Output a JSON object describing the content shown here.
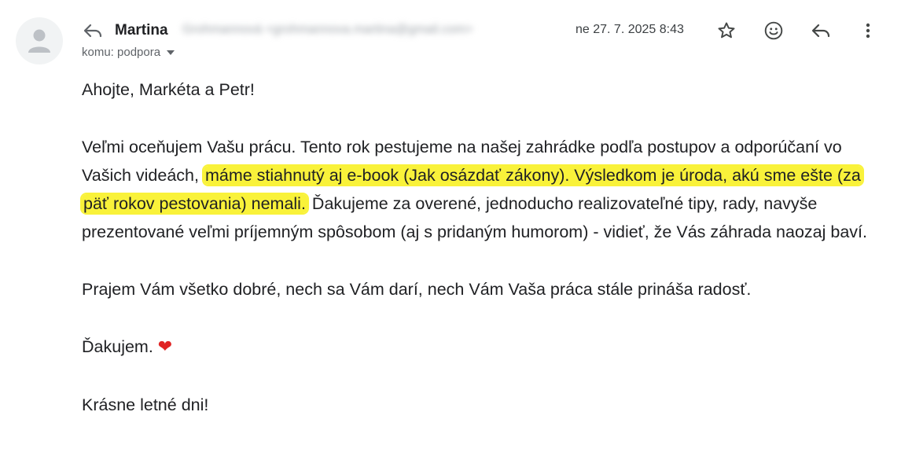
{
  "sender": {
    "name": "Martina",
    "email_redacted": "Grohmannová <grohmannova.martina@gmail.com>",
    "date": "ne 27. 7. 2025 8:43"
  },
  "recipient": {
    "label": "komu: podpora"
  },
  "actions": {
    "star": "star-icon",
    "emoji": "emoji-icon",
    "reply": "reply-icon",
    "more": "more-vert-icon"
  },
  "message": {
    "greeting": "Ahojte, Markéta a Petr!",
    "p1_part1": "Veľmi oceňujem Vašu prácu. Tento rok pestujeme na našej zahrádke podľa postupov a odporúčaní vo Vašich videách, ",
    "p1_highlight": "máme stiahnutý aj e-book (Jak osázdať zákony). Výsledkom je úroda, akú sme ešte (za päť rokov pestovania) nemali.",
    "p1_part2": " Ďakujeme za overené, jednoducho realizovateľné tipy, rady, navyše prezentované veľmi príjemným spôsobom (aj s pridaným humorom) - vidieť, že Vás záhrada naozaj baví.",
    "p2": "Prajem Vám všetko dobré, nech sa Vám darí, nech Vám Vaša práca stále prináša radosť.",
    "thanks": "Ďakujem. ",
    "heart": "❤",
    "closing": "Krásne letné dni!"
  },
  "colors": {
    "highlight": "#f9f23a",
    "heart": "#e02424",
    "text": "#202124",
    "muted": "#5f6368"
  }
}
